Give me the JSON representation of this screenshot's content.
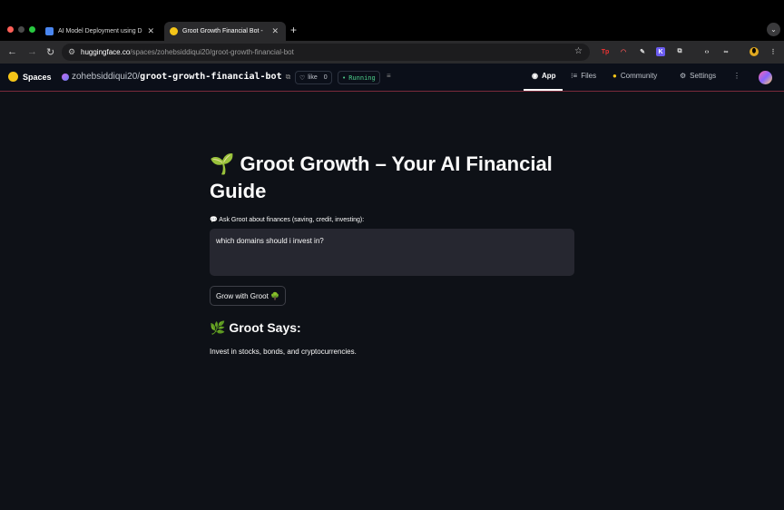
{
  "browser": {
    "tabs": [
      {
        "title": "AI Model Deployment using D",
        "active": false
      },
      {
        "title": "Groot Growth Financial Bot -",
        "active": true
      }
    ],
    "new_tab": "+",
    "url_host": "huggingface.co",
    "url_path": "/spaces/zohebsiddiqui20/groot-growth-financial-bot",
    "colors": {
      "tab_strip": "#000000",
      "toolbar": "#2a2a2c"
    }
  },
  "hf_header": {
    "spaces_label": "Spaces",
    "user": "zohebsiddiqui20/",
    "repo": "groot-growth-financial-bot",
    "like_label": "like",
    "like_count": "0",
    "status": "Running",
    "nav": {
      "app": "App",
      "files": "Files",
      "community": "Community",
      "settings": "Settings"
    }
  },
  "app": {
    "title": "🌱 Groot Growth – Your AI Financial Guide",
    "input_label": "💬 Ask Groot about finances (saving, credit, investing):",
    "input_value": "which domains should i invest in?",
    "button_label": "Grow with Groot 🌳",
    "response_heading": "🌿 Groot Says:",
    "response_text": "Invest in stocks, bonds, and cryptocurrencies.",
    "colors": {
      "background": "#0e1117",
      "input_bg": "#262730",
      "running": "#4ccf8a"
    }
  }
}
